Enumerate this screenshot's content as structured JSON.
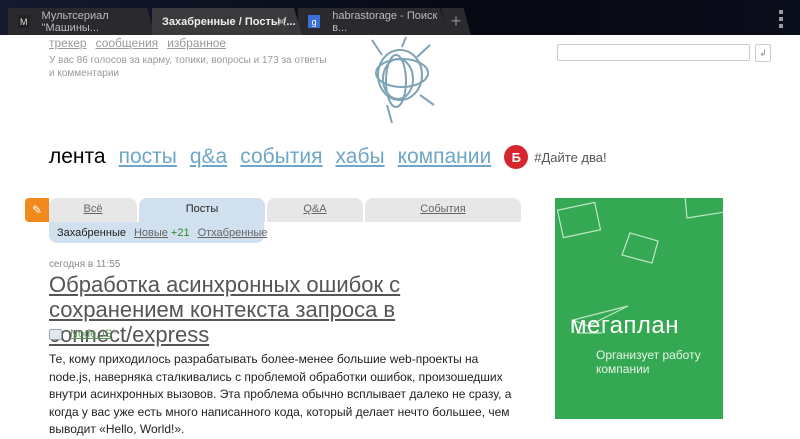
{
  "browser": {
    "tabs": [
      {
        "title": "Мультсериал \"Машины...",
        "favicon": "M"
      },
      {
        "title": "Захабренные / Посты /...",
        "active": true
      },
      {
        "title": "habrastorage - Поиск в...",
        "favicon": "g"
      }
    ]
  },
  "header": {
    "user_links": [
      "трекер",
      "сообщения",
      "избранное"
    ],
    "karma_text": "У вас 86 голосов за карму, топики, вопросы и 173 за ответы и комментарии",
    "search_value": "",
    "search_button": "↲"
  },
  "nav": {
    "current": "лента",
    "links": [
      "посты",
      "q&a",
      "события",
      "хабы",
      "компании"
    ],
    "promo_icon": "Б",
    "promo": "#Дайте два!"
  },
  "post_tabs": [
    {
      "label": "Всё"
    },
    {
      "label": "Посты",
      "active": true
    },
    {
      "label": "Q&A"
    },
    {
      "label": "События"
    }
  ],
  "sub_tabs": {
    "current": "Захабренные",
    "new_label": "Новые",
    "new_count": "+21",
    "other": "Отхабренные"
  },
  "post": {
    "date": "сегодня в 11:55",
    "title": "Обработка асинхронных ошибок с сохранением контекста запроса в connect/express",
    "hub": "Node.JS",
    "hub_suffix": "*",
    "body": "Те, кому приходилось разрабатывать более-менее большие web-проекты на node.js, наверняка сталкивались с проблемой обработки ошибок, произошедших внутри асинхронных вызовов. Эта проблема обычно всплывает далеко не сразу, а когда у вас уже есть много написанного кода, который делает нечто большее, чем выводит «Hello, World!»."
  },
  "ad": {
    "brand": "мегаплан",
    "tagline": "Организует работу компании",
    "color": "#34a852"
  }
}
